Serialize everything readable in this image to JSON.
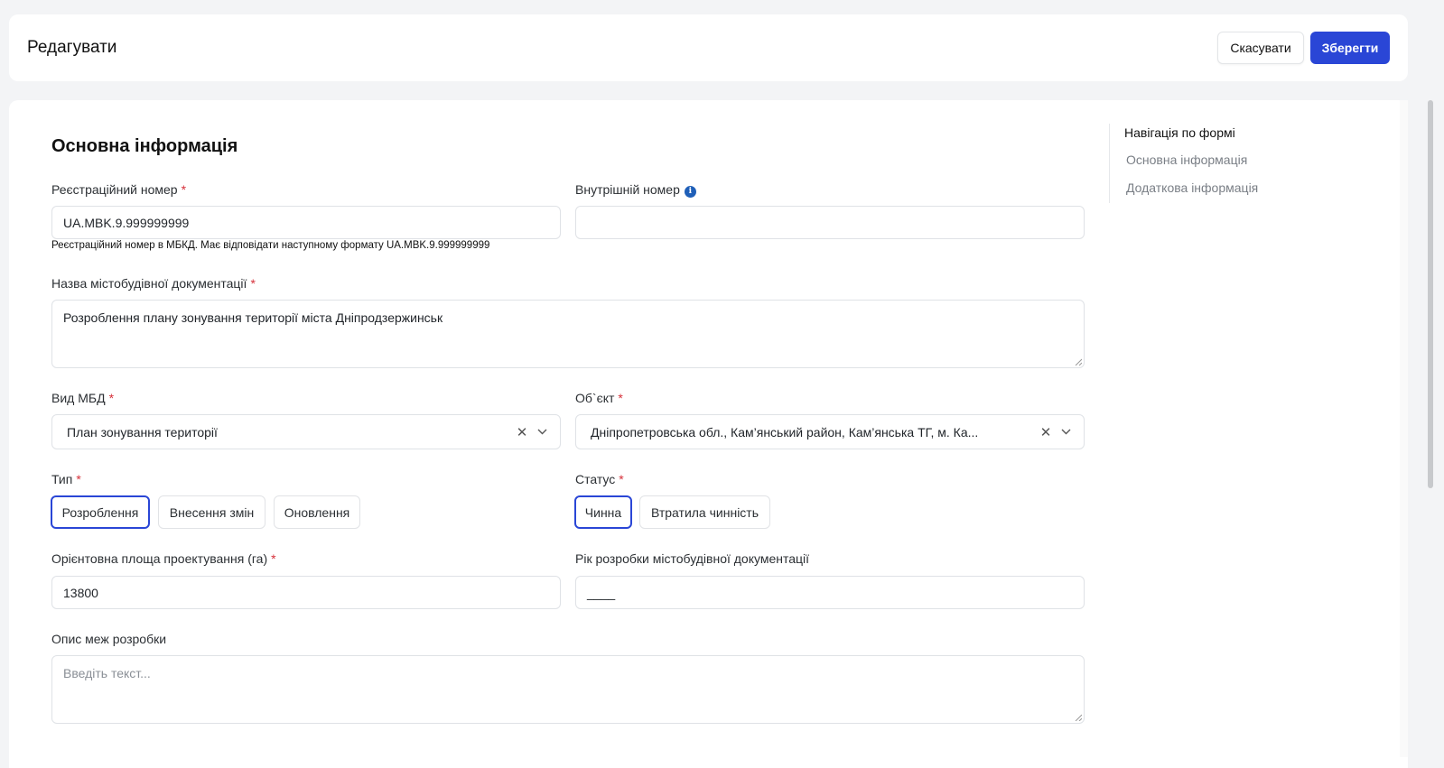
{
  "header": {
    "title": "Редагувати",
    "cancel_label": "Скасувати",
    "save_label": "Зберегти"
  },
  "form": {
    "section_title": "Основна інформація",
    "reg_number": {
      "label": "Реєстраційний номер",
      "value": "UA.MBK.9.999999999",
      "hint": "Реєстраційний номер в МБКД. Має відповідати наступному формату UA.MBK.9.999999999"
    },
    "internal_number": {
      "label": "Внутрішній номер",
      "value": ""
    },
    "doc_name": {
      "label": "Назва містобудівної документації",
      "value": "Розроблення плану зонування території міста Дніпродзержинськ"
    },
    "mbd_type": {
      "label": "Вид МБД",
      "value": "План зонування території"
    },
    "object": {
      "label": "Об`єкт",
      "value": "Дніпропетровська обл., Кам’янський район, Кам’янська ТГ, м. Ка..."
    },
    "type": {
      "label": "Тип",
      "options": [
        "Розроблення",
        "Внесення змін",
        "Оновлення"
      ],
      "selected": "Розроблення"
    },
    "status": {
      "label": "Статус",
      "options": [
        "Чинна",
        "Втратила чинність"
      ],
      "selected": "Чинна"
    },
    "area": {
      "label": "Орієнтовна площа проектування (га)",
      "value": "13800"
    },
    "year": {
      "label": "Рік розробки містобудівної документації",
      "value": "____"
    },
    "boundaries": {
      "label": "Опис меж розробки",
      "placeholder": "Введіть текст..."
    },
    "required_mark": "*",
    "info_glyph": "i"
  },
  "nav": {
    "title": "Навігація по формі",
    "items": [
      "Основна інформація",
      "Додаткова інформація"
    ]
  },
  "colors": {
    "primary": "#2a46d6",
    "required": "#d6303a",
    "info": "#1f5fb8"
  }
}
